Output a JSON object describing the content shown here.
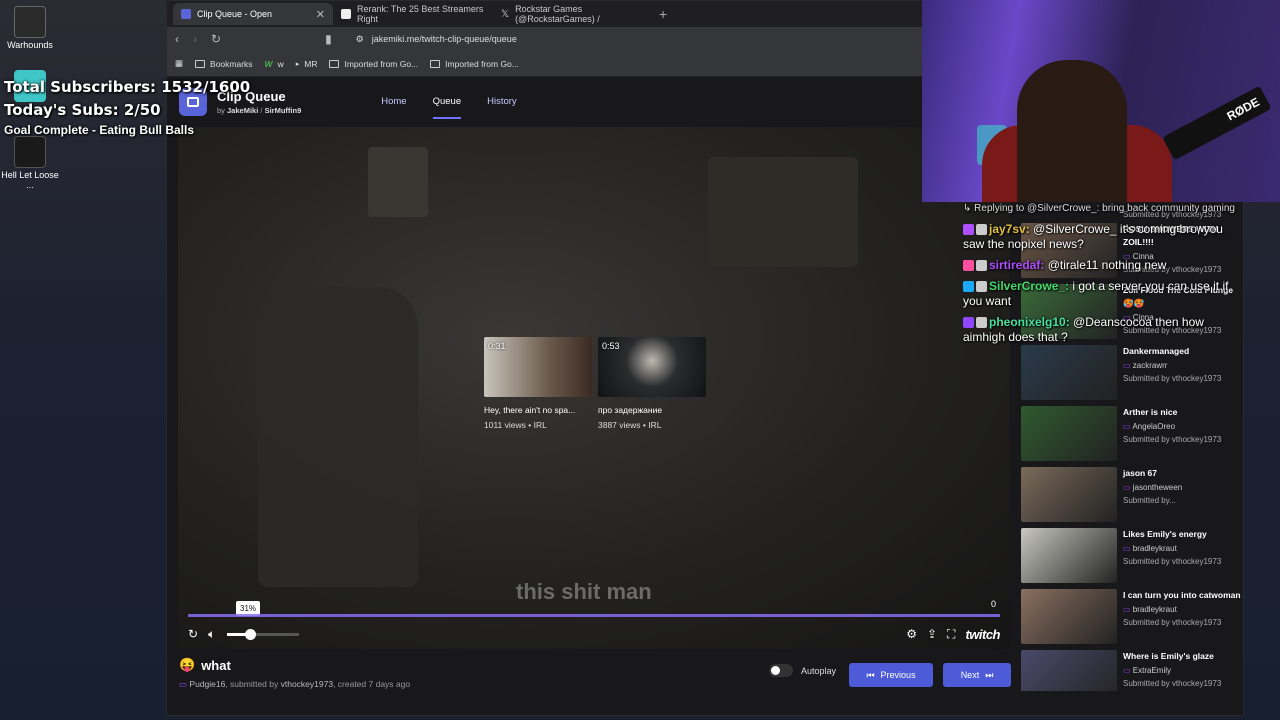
{
  "overlay": {
    "subs_total": "Total Subscribers: 1532/1600",
    "subs_today": "Today's Subs: 2/50",
    "goal": "Goal Complete - Eating Bull Balls"
  },
  "desktop": {
    "icons": [
      {
        "label": "Warhounds"
      },
      {
        "label": "Hell Let Loose ..."
      }
    ]
  },
  "browser": {
    "tabs": [
      {
        "title": "Clip Queue - Open",
        "active": true
      },
      {
        "title": "Rerank: The 25 Best Streamers Right",
        "active": false
      },
      {
        "title": "Rockstar Games (@RockstarGames) /",
        "active": false
      }
    ],
    "url": "jakemiki.me/twitch-clip-queue/queue",
    "bookmarks": [
      "Bookmarks",
      "w",
      "MR",
      "Imported from Go...",
      "Imported from Go..."
    ]
  },
  "app": {
    "title": "Clip Queue",
    "by": "by",
    "author1": "JakeMiki",
    "sep": "/",
    "author2": "SirMuffin9",
    "nav": [
      "Home",
      "Queue",
      "History"
    ],
    "active_nav": "Queue"
  },
  "player": {
    "subtitle": "this shit man",
    "volume_label": "31%",
    "volume": 0.31,
    "counter": "0",
    "brand": "twitch",
    "suggestions": [
      {
        "duration": "0:31",
        "title": "Hey, there ain't no spa...",
        "meta": "1011 views • IRL"
      },
      {
        "duration": "0:53",
        "title": "про задержание",
        "meta": "3887 views • IRL"
      }
    ]
  },
  "clip": {
    "emoji": "😝",
    "title": "what",
    "channel": "Pudgie16",
    "submitted_by_prefix": ", submitted by ",
    "submitter": "vthockey1973",
    "created": ", created 7 days ago"
  },
  "controls": {
    "autoplay": "Autoplay",
    "previous": "Previous",
    "next": "Next"
  },
  "queue": [
    {
      "title": "ROSU SHOWERS WITH ZOIL!!!!",
      "author": "Cinna",
      "submitted": "Submitted by vthockey1973"
    },
    {
      "title": "Zoil Flood The Cold Plunge 🥵🥵",
      "author": "Cinna",
      "submitted": "Submitted by vthockey1973"
    },
    {
      "title": "Dankermanaged",
      "author": "zackrawrr",
      "submitted": "Submitted by vthockey1973"
    },
    {
      "title": "Arther is nice",
      "author": "AngelaOreo",
      "submitted": "Submitted by vthockey1973"
    },
    {
      "title": "jason 67",
      "author": "jasontheween",
      "submitted": "Submitted by..."
    },
    {
      "title": "Likes Emily's energy",
      "author": "bradleykraut",
      "submitted": "Submitted by vthockey1973"
    },
    {
      "title": "I can turn you into catwoman",
      "author": "bradleykraut",
      "submitted": "Submitted by vthockey1973"
    },
    {
      "title": "Where is Emily's glaze",
      "author": "ExtraEmily",
      "submitted": "Submitted by vthockey1973"
    }
  ],
  "queue_top_submitted": "Submitted by vthockey1973",
  "webcam": {
    "mic_brand": "RØDE"
  },
  "chat": [
    {
      "user": "",
      "text": "↳ Replying to @SilverCrowe_: bring back community gaming",
      "color": "#dddddd"
    },
    {
      "user": "jay7sv:",
      "text": " @SilverCrowe_ it's coming bro, you saw the nopixel news?",
      "color": "#e0c040"
    },
    {
      "user": "sirtiredaf:",
      "text": " @tirale11 nothing new",
      "color": "#b04fff"
    },
    {
      "user": "SilverCrowe_:",
      "text": " i got a server you can use it if you want",
      "color": "#46d86c"
    },
    {
      "user": "pheonixelg10:",
      "text": " @Deanscocoa then how aimhigh does that ?",
      "color": "#46e0a0"
    }
  ]
}
